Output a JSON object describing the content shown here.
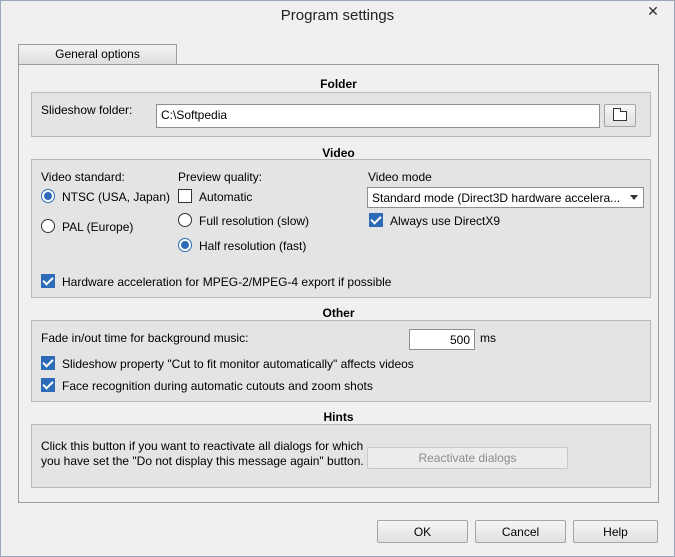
{
  "window": {
    "title": "Program settings",
    "close_glyph": "✕"
  },
  "tab": {
    "label": "General options"
  },
  "folder": {
    "section_title": "Folder",
    "label": "Slideshow folder:",
    "value": "C:\\Softpedia",
    "browse_icon": "folder-icon"
  },
  "video": {
    "section_title": "Video",
    "standard_label": "Video standard:",
    "standard_options": [
      {
        "label": "NTSC (USA, Japan)",
        "checked": true
      },
      {
        "label": "PAL (Europe)",
        "checked": false
      }
    ],
    "preview_label": "Preview quality:",
    "automatic_label": "Automatic",
    "automatic_checked": false,
    "preview_options": [
      {
        "label": "Full resolution (slow)",
        "checked": false
      },
      {
        "label": "Half resolution (fast)",
        "checked": true
      }
    ],
    "mode_label": "Video mode",
    "mode_value": "Standard mode (Direct3D hardware accelera...",
    "directx9_label": "Always use DirectX9",
    "directx9_checked": true,
    "hw_accel_label": "Hardware acceleration for MPEG-2/MPEG-4 export if possible",
    "hw_accel_checked": true
  },
  "other": {
    "section_title": "Other",
    "fade_label": "Fade in/out time for background music:",
    "fade_value": "500",
    "fade_unit": "ms",
    "cut_to_fit_label": "Slideshow property \"Cut to fit monitor automatically\" affects videos",
    "cut_to_fit_checked": true,
    "face_label": "Face recognition during automatic cutouts and zoom shots",
    "face_checked": true
  },
  "hints": {
    "section_title": "Hints",
    "text_line1": "Click this button if you want to reactivate all dialogs for which",
    "text_line2": "you have set the \"Do not display this message again\" button.",
    "reactivate_label": "Reactivate dialogs"
  },
  "buttons": {
    "ok": "OK",
    "cancel": "Cancel",
    "help": "Help"
  },
  "colors": {
    "accent": "#2d6bb8",
    "group_bg": "#e4e4e4",
    "window_bg": "#f0f0f0"
  }
}
